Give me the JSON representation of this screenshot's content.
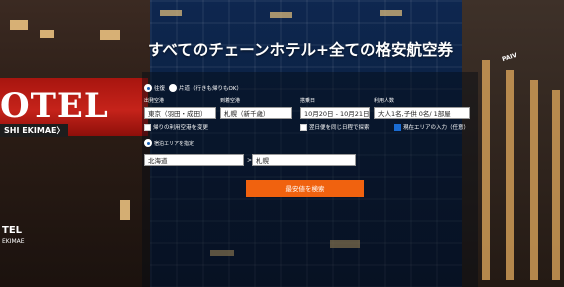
{
  "background": {
    "left_sign": "OTEL",
    "left_sub": "SHI EKIMAE〉",
    "left_sign2": "TEL",
    "left_sub2": "EKIMAE",
    "right_sign": "PAIV"
  },
  "headline": "すべてのチェーンホテル+全ての格安航空券",
  "trip_type": {
    "options": [
      "往復",
      "片道（行きも帰りもOK）"
    ],
    "selected": "往復"
  },
  "fields": {
    "departure": {
      "label": "出発空港",
      "value": "東京（羽田・成田）"
    },
    "arrival": {
      "label": "到着空港",
      "value": "札幌（新千歳）"
    },
    "dates": {
      "label": "搭乗日",
      "value": "10月20日 - 10月21日"
    },
    "guests": {
      "label": "利用人数",
      "value": "大人1名,子供 0名/ 1部屋"
    }
  },
  "checkboxes": {
    "nearby_airport": "帰りの利用空港を変更",
    "next_day_return": "翌日便を同じ日程で探索",
    "current_area": "現在エリアの入力（任意）"
  },
  "hotel_area": {
    "option_label": "宿泊エリアを指定",
    "prefecture": "北海道",
    "city": "札幌",
    "separator": ">"
  },
  "search_button": "最安値を検索",
  "colors": {
    "accent": "#f0620f",
    "radio_selected": "#1a5fb4"
  }
}
